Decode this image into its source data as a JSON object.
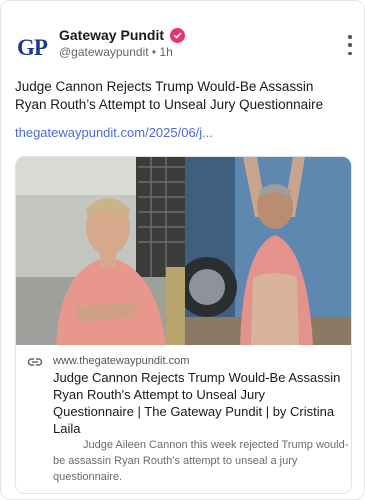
{
  "post": {
    "author_name": "Gateway Pundit",
    "avatar_text": "GP",
    "handle": "@gatewaypundit",
    "separator": "•",
    "time": "1h",
    "text": "Judge Cannon Rejects Trump Would-Be Assassin Ryan Routh’s Attempt to Unseal Jury Questionnaire",
    "link_text": "thegatewaypundit.com/2025/06/j...",
    "icons": {
      "verified": "verified-badge-icon",
      "more": "more-options-icon",
      "link": "link-icon"
    }
  },
  "link_card": {
    "domain": "www.thegatewaypundit.com",
    "title": "Judge Cannon Rejects Trump Would-Be Assassin Ryan Routh's Attempt to Unseal Jury Questionnaire | The Gateway Pundit | by Cristina Laila",
    "description": "Judge Aileen Cannon this week rejected Trump would-be assassin Ryan Routh’s attempt to unseal a jury questionnaire."
  },
  "colors": {
    "avatar_text": "#1b3a8c",
    "verified_badge": "#e8356b",
    "link": "#4a6bd6",
    "muted_text": "#666666"
  }
}
